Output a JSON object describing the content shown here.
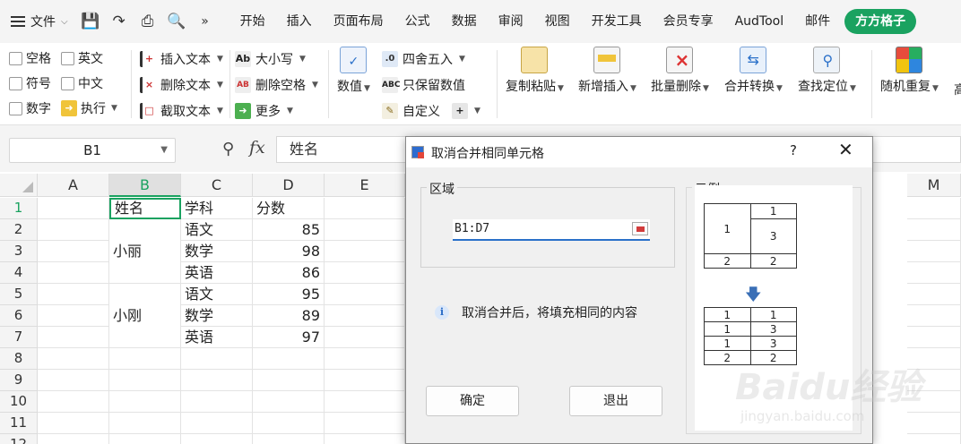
{
  "menubar": {
    "file_label": "文件",
    "tabs": [
      "开始",
      "插入",
      "页面布局",
      "公式",
      "数据",
      "审阅",
      "视图",
      "开发工具",
      "会员专享",
      "AudTool",
      "邮件"
    ],
    "special_tab": "方方格子"
  },
  "ribbon": {
    "checkbox_group": [
      "空格",
      "英文",
      "符号",
      "中文",
      "数字"
    ],
    "exec_label": "执行",
    "text_group": [
      "插入文本",
      "删除文本",
      "截取文本"
    ],
    "case_group": [
      "大小写",
      "删除空格",
      "更多"
    ],
    "value_label": "数值",
    "number_group": [
      "四舍五入",
      "只保留数值",
      "自定义"
    ],
    "big_buttons": [
      "复制粘贴",
      "新增插入",
      "批量删除",
      "合并转换",
      "查找定位",
      "随机重复",
      "高"
    ]
  },
  "formula_bar": {
    "name_box": "B1",
    "formula": "姓名"
  },
  "sheet": {
    "columns": [
      "A",
      "B",
      "C",
      "D",
      "E",
      "M"
    ],
    "rows": [
      "1",
      "2",
      "3",
      "4",
      "5",
      "6",
      "7",
      "8",
      "9",
      "10",
      "11",
      "12"
    ],
    "cells": {
      "B1": "姓名",
      "C1": "学科",
      "D1": "分数",
      "C2": "语文",
      "D2": "85",
      "B3": "小丽",
      "C3": "数学",
      "D3": "98",
      "C4": "英语",
      "D4": "86",
      "C5": "语文",
      "D5": "95",
      "B6": "小刚",
      "C6": "数学",
      "D6": "89",
      "C7": "英语",
      "D7": "97"
    }
  },
  "dialog": {
    "title": "取消合并相同单元格",
    "help": "?",
    "close": "✕",
    "region_legend": "区域",
    "range_value": "B1:D7",
    "info_text": "取消合并后，将填充相同的内容",
    "ok_label": "确定",
    "exit_label": "退出",
    "example_legend": "示例",
    "example_before": [
      [
        "1",
        "1"
      ],
      [
        "",
        "3"
      ],
      [
        "2",
        "2"
      ]
    ],
    "example_after": [
      [
        "1",
        "1"
      ],
      [
        "1",
        "3"
      ],
      [
        "1",
        "3"
      ],
      [
        "2",
        "2"
      ]
    ]
  },
  "watermark": {
    "logo": "Baidu经验",
    "url": "jingyan.baidu.com"
  }
}
